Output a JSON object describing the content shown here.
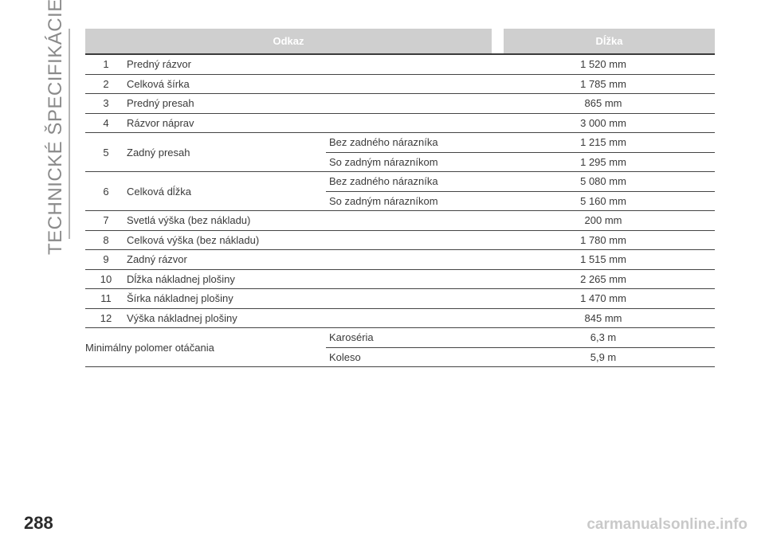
{
  "side_title": "TECHNICKÉ ŠPECIFIKÁCIE",
  "page_number": "288",
  "watermark": "carmanualsonline.info",
  "table": {
    "header": {
      "reference": "Odkaz",
      "length": "Dĺžka"
    },
    "rows": [
      {
        "num": "1",
        "label": "Predný rázvor",
        "value": "1 520 mm"
      },
      {
        "num": "2",
        "label": "Celková šírka",
        "value": "1 785 mm"
      },
      {
        "num": "3",
        "label": "Predný presah",
        "value": "865 mm"
      },
      {
        "num": "4",
        "label": "Rázvor náprav",
        "value": "3 000 mm"
      },
      {
        "num": "5",
        "label": "Zadný presah",
        "variants": [
          {
            "condition": "Bez zadného nárazníka",
            "value": "1 215 mm"
          },
          {
            "condition": "So zadným nárazníkom",
            "value": "1 295 mm"
          }
        ]
      },
      {
        "num": "6",
        "label": "Celková dĺžka",
        "variants": [
          {
            "condition": "Bez zadného nárazníka",
            "value": "5 080 mm"
          },
          {
            "condition": "So zadným nárazníkom",
            "value": "5 160 mm"
          }
        ]
      },
      {
        "num": "7",
        "label": "Svetlá výška (bez nákladu)",
        "value": "200 mm"
      },
      {
        "num": "8",
        "label": "Celková výška (bez nákladu)",
        "value": "1 780 mm"
      },
      {
        "num": "9",
        "label": "Zadný rázvor",
        "value": "1 515 mm"
      },
      {
        "num": "10",
        "label": "Dĺžka nákladnej plošiny",
        "value": "2 265 mm"
      },
      {
        "num": "11",
        "label": "Šírka nákladnej plošiny",
        "value": "1 470 mm"
      },
      {
        "num": "12",
        "label": "Výška nákladnej plošiny",
        "value": "845 mm"
      }
    ],
    "turning": {
      "label": "Minimálny polomer otáčania",
      "variants": [
        {
          "condition": "Karoséria",
          "value": "6,3 m"
        },
        {
          "condition": "Koleso",
          "value": "5,9 m"
        }
      ]
    }
  }
}
